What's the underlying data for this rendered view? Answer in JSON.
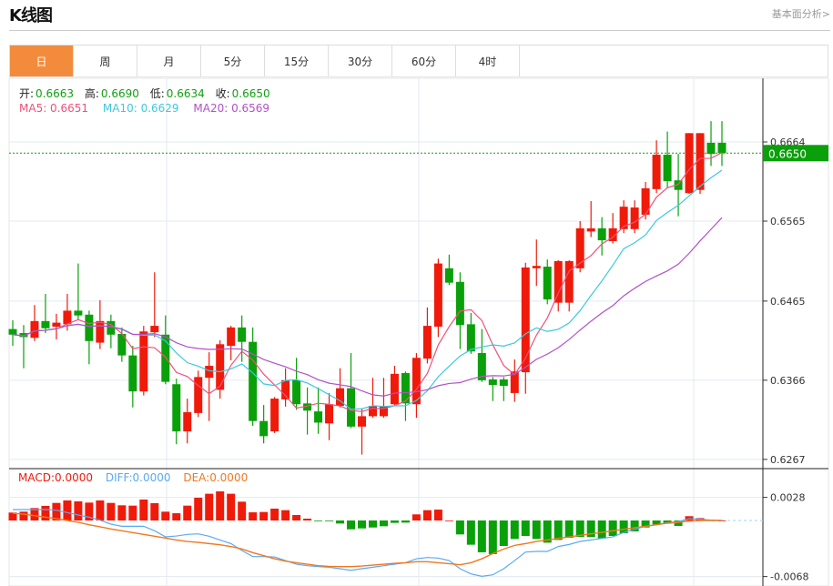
{
  "header": {
    "title": "K线图",
    "more_link": "基本面分析>"
  },
  "tabs": [
    {
      "label": "日",
      "active": true
    },
    {
      "label": "周"
    },
    {
      "label": "月"
    },
    {
      "label": "5分"
    },
    {
      "label": "15分"
    },
    {
      "label": "30分"
    },
    {
      "label": "60分"
    },
    {
      "label": "4时"
    }
  ],
  "ohlc": {
    "open_label": "开:",
    "open": "0.6663",
    "high_label": "高:",
    "high": "0.6690",
    "low_label": "低:",
    "low": "0.6634",
    "close_label": "收:",
    "close": "0.6650"
  },
  "ma": {
    "ma5": "MA5: 0.6651",
    "ma10": "MA10: 0.6629",
    "ma20": "MA20: 0.6569"
  },
  "macd_info": {
    "macd": "MACD:0.0000",
    "diff": "DIFF:0.0000",
    "dea": "DEA:0.0000"
  },
  "colors": {
    "up": "#f01a0a",
    "down": "#0aa00a",
    "ma5": "#f0507a",
    "ma10": "#3cc8e0",
    "ma20": "#b450c8",
    "diff": "#5aaaf0",
    "dea": "#f07820",
    "active_tab": "#f28c3c",
    "last_price_bg": "#0aa00a"
  },
  "chart_data": {
    "type": "candlestick",
    "price_ticks": [
      "0.6664",
      "0.6565",
      "0.6465",
      "0.6366",
      "0.6267"
    ],
    "last_price": "0.6650",
    "macd_ticks": [
      "0.0028",
      "-0.0068"
    ],
    "candles_ochl_note": "[open, close, high, low]",
    "candles": [
      [
        0.643,
        0.6423,
        0.6441,
        0.6409
      ],
      [
        0.6425,
        0.642,
        0.6435,
        0.6381
      ],
      [
        0.6419,
        0.644,
        0.646,
        0.6415
      ],
      [
        0.644,
        0.6431,
        0.6474,
        0.6425
      ],
      [
        0.6433,
        0.6438,
        0.6449,
        0.6417
      ],
      [
        0.6436,
        0.6453,
        0.6474,
        0.6428
      ],
      [
        0.6453,
        0.6447,
        0.6512,
        0.6441
      ],
      [
        0.6448,
        0.6415,
        0.6453,
        0.6386
      ],
      [
        0.6413,
        0.644,
        0.6466,
        0.6405
      ],
      [
        0.644,
        0.6423,
        0.6448,
        0.6406
      ],
      [
        0.6424,
        0.6397,
        0.6432,
        0.6389
      ],
      [
        0.6397,
        0.6352,
        0.6409,
        0.6332
      ],
      [
        0.6352,
        0.6427,
        0.6434,
        0.6347
      ],
      [
        0.6426,
        0.6434,
        0.6501,
        0.642
      ],
      [
        0.6423,
        0.6364,
        0.6447,
        0.6361
      ],
      [
        0.6361,
        0.6302,
        0.6368,
        0.6286
      ],
      [
        0.6302,
        0.6326,
        0.6343,
        0.6287
      ],
      [
        0.6325,
        0.637,
        0.6378,
        0.632
      ],
      [
        0.6369,
        0.6384,
        0.6401,
        0.6315
      ],
      [
        0.6354,
        0.6411,
        0.6416,
        0.6343
      ],
      [
        0.6409,
        0.6432,
        0.6434,
        0.6391
      ],
      [
        0.6432,
        0.6414,
        0.6447,
        0.6389
      ],
      [
        0.6414,
        0.6315,
        0.6432,
        0.6309
      ],
      [
        0.6315,
        0.6296,
        0.6335,
        0.6287
      ],
      [
        0.6302,
        0.6343,
        0.6345,
        0.63
      ],
      [
        0.6342,
        0.6366,
        0.6381,
        0.6333
      ],
      [
        0.6366,
        0.6336,
        0.6394,
        0.6329
      ],
      [
        0.6337,
        0.6328,
        0.6357,
        0.6298
      ],
      [
        0.6327,
        0.6313,
        0.6357,
        0.6299
      ],
      [
        0.6312,
        0.6336,
        0.635,
        0.6291
      ],
      [
        0.6334,
        0.6356,
        0.6381,
        0.6332
      ],
      [
        0.6356,
        0.6308,
        0.64,
        0.6306
      ],
      [
        0.6308,
        0.6321,
        0.6331,
        0.6273
      ],
      [
        0.6321,
        0.6334,
        0.6369,
        0.6319
      ],
      [
        0.6321,
        0.6334,
        0.6369,
        0.6319
      ],
      [
        0.6336,
        0.6374,
        0.6384,
        0.6334
      ],
      [
        0.6375,
        0.6337,
        0.6377,
        0.6315
      ],
      [
        0.6336,
        0.6394,
        0.64,
        0.6319
      ],
      [
        0.6393,
        0.6434,
        0.6457,
        0.6387
      ],
      [
        0.6433,
        0.6512,
        0.6518,
        0.642
      ],
      [
        0.6506,
        0.6488,
        0.6523,
        0.6485
      ],
      [
        0.6489,
        0.6435,
        0.6501,
        0.6405
      ],
      [
        0.6436,
        0.6402,
        0.645,
        0.6399
      ],
      [
        0.64,
        0.6366,
        0.643,
        0.6364
      ],
      [
        0.6367,
        0.636,
        0.637,
        0.634
      ],
      [
        0.6367,
        0.6359,
        0.637,
        0.634
      ],
      [
        0.635,
        0.6377,
        0.6392,
        0.6339
      ],
      [
        0.6376,
        0.6507,
        0.6513,
        0.6349
      ],
      [
        0.6506,
        0.6509,
        0.6542,
        0.6484
      ],
      [
        0.6508,
        0.6467,
        0.6517,
        0.6461
      ],
      [
        0.6463,
        0.6515,
        0.6516,
        0.6452
      ],
      [
        0.6463,
        0.6515,
        0.6516,
        0.6452
      ],
      [
        0.6506,
        0.6556,
        0.6565,
        0.6501
      ],
      [
        0.6552,
        0.6556,
        0.659,
        0.6545
      ],
      [
        0.6556,
        0.6541,
        0.657,
        0.6522
      ],
      [
        0.654,
        0.6556,
        0.6575,
        0.6537
      ],
      [
        0.6555,
        0.6583,
        0.6591,
        0.655
      ],
      [
        0.6555,
        0.6582,
        0.6591,
        0.655
      ],
      [
        0.6573,
        0.6606,
        0.6614,
        0.6567
      ],
      [
        0.6605,
        0.6648,
        0.6666,
        0.66
      ],
      [
        0.6648,
        0.6615,
        0.6677,
        0.6606
      ],
      [
        0.6616,
        0.6604,
        0.6649,
        0.6571
      ],
      [
        0.66,
        0.6675,
        0.6675,
        0.6599
      ],
      [
        0.6604,
        0.6675,
        0.6675,
        0.6599
      ],
      [
        0.6663,
        0.6649,
        0.669,
        0.6634
      ],
      [
        0.6663,
        0.665,
        0.669,
        0.6634
      ]
    ],
    "macd_hist": [
      0.00096,
      0.00107,
      0.00151,
      0.00177,
      0.00213,
      0.00243,
      0.00232,
      0.00217,
      0.00243,
      0.00213,
      0.00184,
      0.0018,
      0.00254,
      0.0021,
      0.00107,
      0.00088,
      0.0018,
      0.00276,
      0.00324,
      0.00353,
      0.00324,
      0.00228,
      0.00099,
      0.00103,
      0.00144,
      0.00125,
      0.00066,
      0.00022,
      -3e-05,
      -3e-05,
      -0.00037,
      -0.00107,
      -0.00096,
      -0.00085,
      -0.0007,
      -0.00029,
      -0.00026,
      0.00074,
      0.00125,
      0.00132,
      0.0,
      -0.00169,
      -0.00294,
      -0.00386,
      -0.00408,
      -0.00309,
      -0.00224,
      -0.00188,
      -0.00224,
      -0.00269,
      -0.00236,
      -0.0021,
      -0.00199,
      -0.00202,
      -0.00217,
      -0.00188,
      -0.00155,
      -0.00132,
      -0.00085,
      -0.00048,
      -0.00037,
      -0.00066,
      0.00052,
      0.00029,
      0.00011,
      0.0
    ],
    "diff": [
      0.00132,
      0.00132,
      0.00132,
      0.00132,
      0.00125,
      0.00096,
      0.00066,
      0.0004,
      4e-05,
      -0.00044,
      -0.0007,
      -0.0007,
      -0.0007,
      -0.00125,
      -0.00199,
      -0.00188,
      -0.00169,
      -0.00162,
      -0.00191,
      -0.00236,
      -0.0028,
      -0.00364,
      -0.00438,
      -0.00438,
      -0.00442,
      -0.00486,
      -0.0053,
      -0.00548,
      -0.00559,
      -0.00567,
      -0.00585,
      -0.00604,
      -0.00585,
      -0.00567,
      -0.00548,
      -0.0053,
      -0.00512,
      -0.00464,
      -0.00449,
      -0.00456,
      -0.00486,
      -0.00585,
      -0.00648,
      -0.00677,
      -0.00659,
      -0.00585,
      -0.00486,
      -0.00383,
      -0.00375,
      -0.00375,
      -0.00316,
      -0.00291,
      -0.00254,
      -0.00236,
      -0.00217,
      -0.00199,
      -0.00144,
      -0.00107,
      -0.0007,
      -0.00052,
      -0.00026,
      -0.00015,
      0.00022,
      0.00015,
      4e-05,
      0.0
    ],
    "dea": [
      0.00088,
      0.00077,
      0.00059,
      0.0004,
      0.00022,
      0.0,
      -0.00022,
      -0.00052,
      -0.00077,
      -0.00103,
      -0.00125,
      -0.00147,
      -0.00169,
      -0.00191,
      -0.00213,
      -0.00236,
      -0.00254,
      -0.00265,
      -0.0028,
      -0.00294,
      -0.00316,
      -0.00346,
      -0.0039,
      -0.00427,
      -0.00464,
      -0.00493,
      -0.00512,
      -0.0053,
      -0.00548,
      -0.00556,
      -0.00559,
      -0.00559,
      -0.00552,
      -0.00541,
      -0.0053,
      -0.00519,
      -0.00512,
      -0.005,
      -0.005,
      -0.00512,
      -0.00523,
      -0.00537,
      -0.00512,
      -0.00464,
      -0.00401,
      -0.00346,
      -0.00302,
      -0.0028,
      -0.00254,
      -0.00236,
      -0.00217,
      -0.00199,
      -0.0018,
      -0.00162,
      -0.00144,
      -0.00125,
      -0.00107,
      -0.00088,
      -0.0007,
      -0.00052,
      -0.00033,
      -0.00022,
      -7e-05,
      0.0,
      0.0,
      0.0
    ]
  }
}
